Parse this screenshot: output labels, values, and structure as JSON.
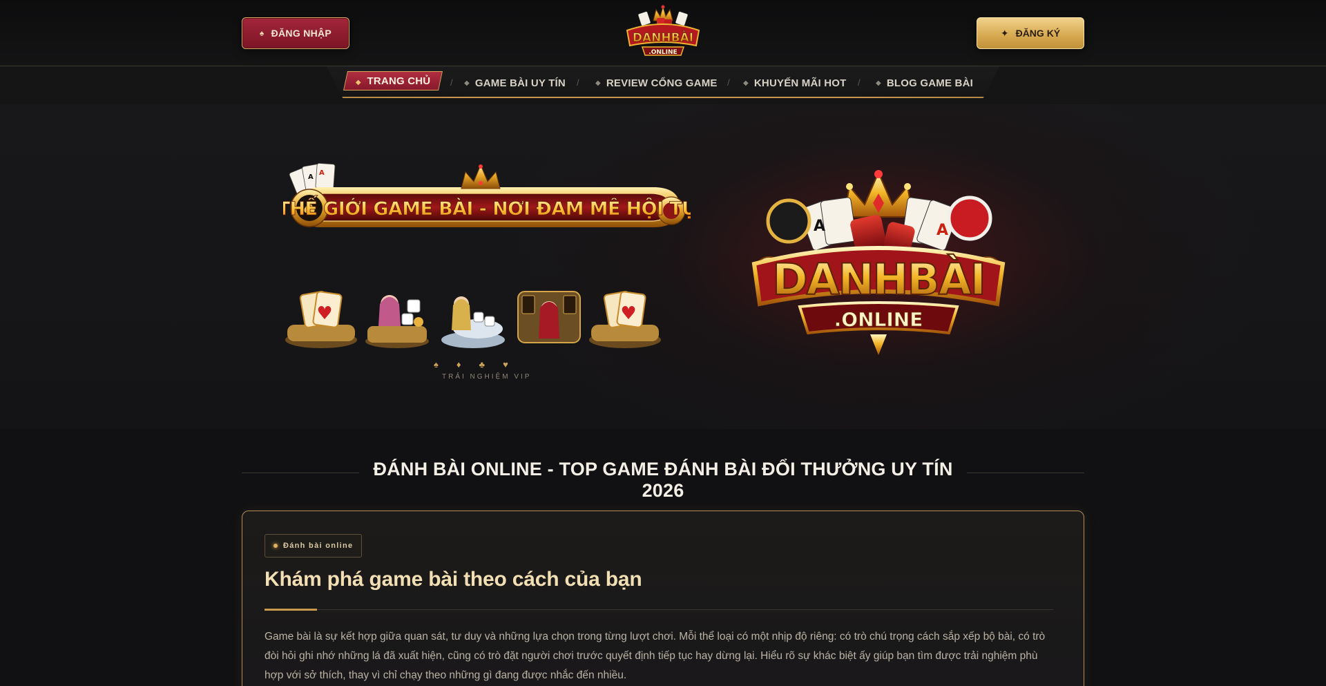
{
  "header": {
    "login_label": "ĐĂNG NHẬP",
    "register_label": "ĐĂNG KÝ",
    "logo_text_top": "DANHBÀI",
    "logo_text_bottom": ".ONLINE"
  },
  "nav": {
    "items": [
      {
        "label": "TRANG CHỦ",
        "active": true
      },
      {
        "label": "GAME BÀI UY TÍN",
        "active": false
      },
      {
        "label": "REVIEW CỔNG GAME",
        "active": false
      },
      {
        "label": "KHUYẾN MÃI HOT",
        "active": false
      },
      {
        "label": "BLOG GAME BÀI",
        "active": false
      }
    ],
    "separator": "/"
  },
  "hero": {
    "banner_text": "THẾ GIỚI GAME BÀI - NƠI ĐAM MÊ HỘI TỤ",
    "suits": [
      "♠",
      "♦",
      "♣",
      "♥"
    ],
    "vip_text": "TRẢI NGHIỆM VIP",
    "logo_text_top": "DANHBÀI",
    "logo_text_bottom": ".ONLINE"
  },
  "section": {
    "title": "ĐÁNH BÀI ONLINE - TOP GAME ĐÁNH BÀI ĐỔI THƯỞNG UY TÍN 2026"
  },
  "card": {
    "tag": "Đánh bài online",
    "heading": "Khám phá game bài theo cách của bạn",
    "body": "Game bài là sự kết hợp giữa quan sát, tư duy và những lựa chọn trong từng lượt chơi. Mỗi thể loại có một nhịp độ riêng: có trò chú trọng cách sắp xếp bộ bài, có trò đòi hỏi ghi nhớ những lá đã xuất hiện, cũng có trò đặt người chơi trước quyết định tiếp tục hay dừng lại. Hiểu rõ sự khác biệt ấy giúp bạn tìm được trải nghiệm phù hợp với sở thích, thay vì chỉ chạy theo những gì đang được nhắc đến nhiều."
  },
  "colors": {
    "gold": "#d6a84f",
    "crimson": "#a3263a",
    "background": "#111113"
  },
  "icons": {
    "login": "spade-icon",
    "register": "sparkle-icon"
  }
}
